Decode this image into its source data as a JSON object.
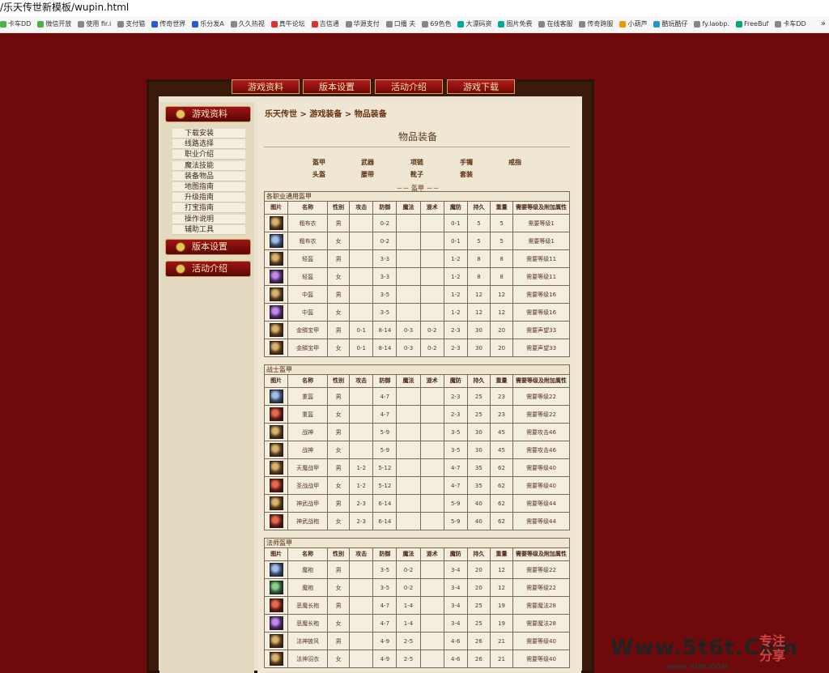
{
  "browser": {
    "address": "/乐天传世新模板/wupin.html",
    "bookmarks": [
      "卡车DD",
      "微信开放",
      "使用 fir.i",
      "支付猫",
      "传奇世界",
      "乐分发A",
      "久久热视",
      "真牛论坛",
      "吉信通",
      "华源支付",
      "口播 夫",
      "69色色",
      "大漂码资",
      "图片免费",
      "在线客服",
      "传奇跨服",
      "小葫芦",
      "酷玩酷仔",
      "fy.laobp.",
      "FreeBuf",
      "卡车DD"
    ],
    "more": "»"
  },
  "top_nav": [
    "游戏资料",
    "版本设置",
    "活动介绍",
    "游戏下载"
  ],
  "sidebar": {
    "sections": [
      {
        "title": "游戏资料",
        "items": [
          "下载安装",
          "线路选择",
          "职业介绍",
          "魔法技能",
          "装备物品",
          "地图指南",
          "升级指南",
          "打宝指南",
          "操作说明",
          "辅助工具"
        ]
      },
      {
        "title": "版本设置",
        "items": []
      },
      {
        "title": "活动介绍",
        "items": []
      }
    ]
  },
  "breadcrumb": {
    "home": "乐天传世",
    "sep": ">",
    "level1": "游戏装备",
    "current": "物品装备"
  },
  "page_title": "物品装备",
  "categories": [
    "盔甲",
    "武器",
    "项链",
    "手镯",
    "戒指",
    "头盔",
    "腰带",
    "靴子",
    "套装"
  ],
  "section_marker": "－－ 盔甲 －－",
  "columns": [
    "图片",
    "名称",
    "性别",
    "攻击",
    "防御",
    "魔法",
    "道术",
    "魔防",
    "持久",
    "重量",
    "需要等级及附加属性"
  ],
  "tables": [
    {
      "caption": "各职业通用盔甲",
      "rows": [
        [
          "gold",
          "粗布衣",
          "男",
          "",
          "0-2",
          "",
          "",
          "0-1",
          "5",
          "5",
          "需要等级1"
        ],
        [
          "blue",
          "粗布衣",
          "女",
          "",
          "0-2",
          "",
          "",
          "0-1",
          "5",
          "5",
          "需要等级1"
        ],
        [
          "gold",
          "轻盔",
          "男",
          "",
          "3-3",
          "",
          "",
          "1-2",
          "8",
          "8",
          "需要等级11"
        ],
        [
          "purple",
          "轻盔",
          "女",
          "",
          "3-3",
          "",
          "",
          "1-2",
          "8",
          "8",
          "需要等级11"
        ],
        [
          "gold",
          "中盔",
          "男",
          "",
          "3-5",
          "",
          "",
          "1-2",
          "12",
          "12",
          "需要等级16"
        ],
        [
          "purple",
          "中盔",
          "女",
          "",
          "3-5",
          "",
          "",
          "1-2",
          "12",
          "12",
          "需要等级16"
        ],
        [
          "gold",
          "金鳞宝甲",
          "男",
          "0-1",
          "8-14",
          "0-3",
          "0-2",
          "2-3",
          "30",
          "20",
          "需要声望33"
        ],
        [
          "gold",
          "金鳞宝甲",
          "女",
          "0-1",
          "8-14",
          "0-3",
          "0-2",
          "2-3",
          "30",
          "20",
          "需要声望33"
        ]
      ]
    },
    {
      "caption": "战士盔甲",
      "rows": [
        [
          "blue",
          "重盔",
          "男",
          "",
          "4-7",
          "",
          "",
          "2-3",
          "25",
          "23",
          "需要等级22"
        ],
        [
          "red",
          "重盔",
          "女",
          "",
          "4-7",
          "",
          "",
          "2-3",
          "25",
          "23",
          "需要等级22"
        ],
        [
          "gold",
          "战神",
          "男",
          "",
          "5-9",
          "",
          "",
          "3-5",
          "30",
          "45",
          "需要攻击46"
        ],
        [
          "gold",
          "战神",
          "女",
          "",
          "5-9",
          "",
          "",
          "3-5",
          "30",
          "45",
          "需要攻击46"
        ],
        [
          "gold",
          "天魔战甲",
          "男",
          "1-2",
          "5-12",
          "",
          "",
          "4-7",
          "35",
          "62",
          "需要等级40"
        ],
        [
          "red",
          "圣战战甲",
          "女",
          "1-2",
          "5-12",
          "",
          "",
          "4-7",
          "35",
          "62",
          "需要等级40"
        ],
        [
          "gold",
          "神武战甲",
          "男",
          "2-3",
          "6-14",
          "",
          "",
          "5-9",
          "40",
          "62",
          "需要等级44"
        ],
        [
          "red",
          "神武战袍",
          "女",
          "2-3",
          "6-14",
          "",
          "",
          "5-9",
          "40",
          "62",
          "需要等级44"
        ]
      ]
    },
    {
      "caption": "法师盔甲",
      "rows": [
        [
          "blue",
          "魔袍",
          "男",
          "",
          "3-5",
          "0-2",
          "",
          "3-4",
          "20",
          "12",
          "需要等级22"
        ],
        [
          "green",
          "魔袍",
          "女",
          "",
          "3-5",
          "0-2",
          "",
          "3-4",
          "20",
          "12",
          "需要等级22"
        ],
        [
          "red",
          "恶魔长袍",
          "男",
          "",
          "4-7",
          "1-4",
          "",
          "3-4",
          "25",
          "19",
          "需要魔法28"
        ],
        [
          "purple",
          "恶魔长袍",
          "女",
          "",
          "4-7",
          "1-4",
          "",
          "3-4",
          "25",
          "19",
          "需要魔法28"
        ],
        [
          "gold",
          "法神披风",
          "男",
          "",
          "4-9",
          "2-5",
          "",
          "4-6",
          "26",
          "21",
          "需要等级40"
        ],
        [
          "gold",
          "法神羽衣",
          "女",
          "",
          "4-9",
          "2-5",
          "",
          "4-6",
          "26",
          "21",
          "需要等级40"
        ]
      ]
    }
  ],
  "watermark": {
    "main": "Www.5t6t.Com",
    "highlight": "5t6t",
    "sub": "www.5t6t.COM",
    "tag": "专注分享",
    "num": "1"
  }
}
